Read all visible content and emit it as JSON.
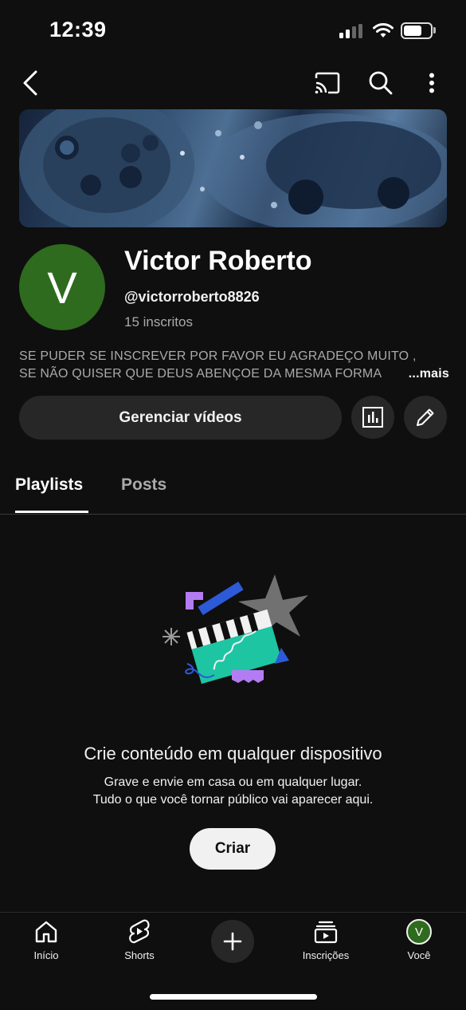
{
  "status_bar": {
    "time": "12:39"
  },
  "channel": {
    "name": "Victor Roberto",
    "handle": "@victorroberto8826",
    "subscribers": "15 inscritos",
    "avatar_letter": "V",
    "avatar_color": "#2e6b1e",
    "description_line1": "SE PUDER SE INSCREVER POR FAVOR EU AGRADEÇO MUITO ,",
    "description_line2": "SE NÃO QUISER QUE DEUS ABENÇOE DA MESMA FORMA",
    "more_label": "...mais"
  },
  "actions": {
    "manage_videos": "Gerenciar vídeos"
  },
  "tabs": [
    {
      "label": "Playlists",
      "active": true
    },
    {
      "label": "Posts",
      "active": false
    }
  ],
  "empty_state": {
    "title": "Crie conteúdo em qualquer dispositivo",
    "line1": "Grave e envie em casa ou em qualquer lugar.",
    "line2": "Tudo o que você tornar público vai aparecer aqui.",
    "button": "Criar"
  },
  "bottom_nav": {
    "home": "Início",
    "shorts": "Shorts",
    "subscriptions": "Inscrições",
    "you": "Você",
    "you_avatar_letter": "V"
  },
  "icons": [
    "back-icon",
    "cast-icon",
    "search-icon",
    "more-vert-icon",
    "stats-icon",
    "pencil-icon",
    "home-icon",
    "shorts-icon",
    "plus-icon",
    "subscriptions-icon"
  ]
}
